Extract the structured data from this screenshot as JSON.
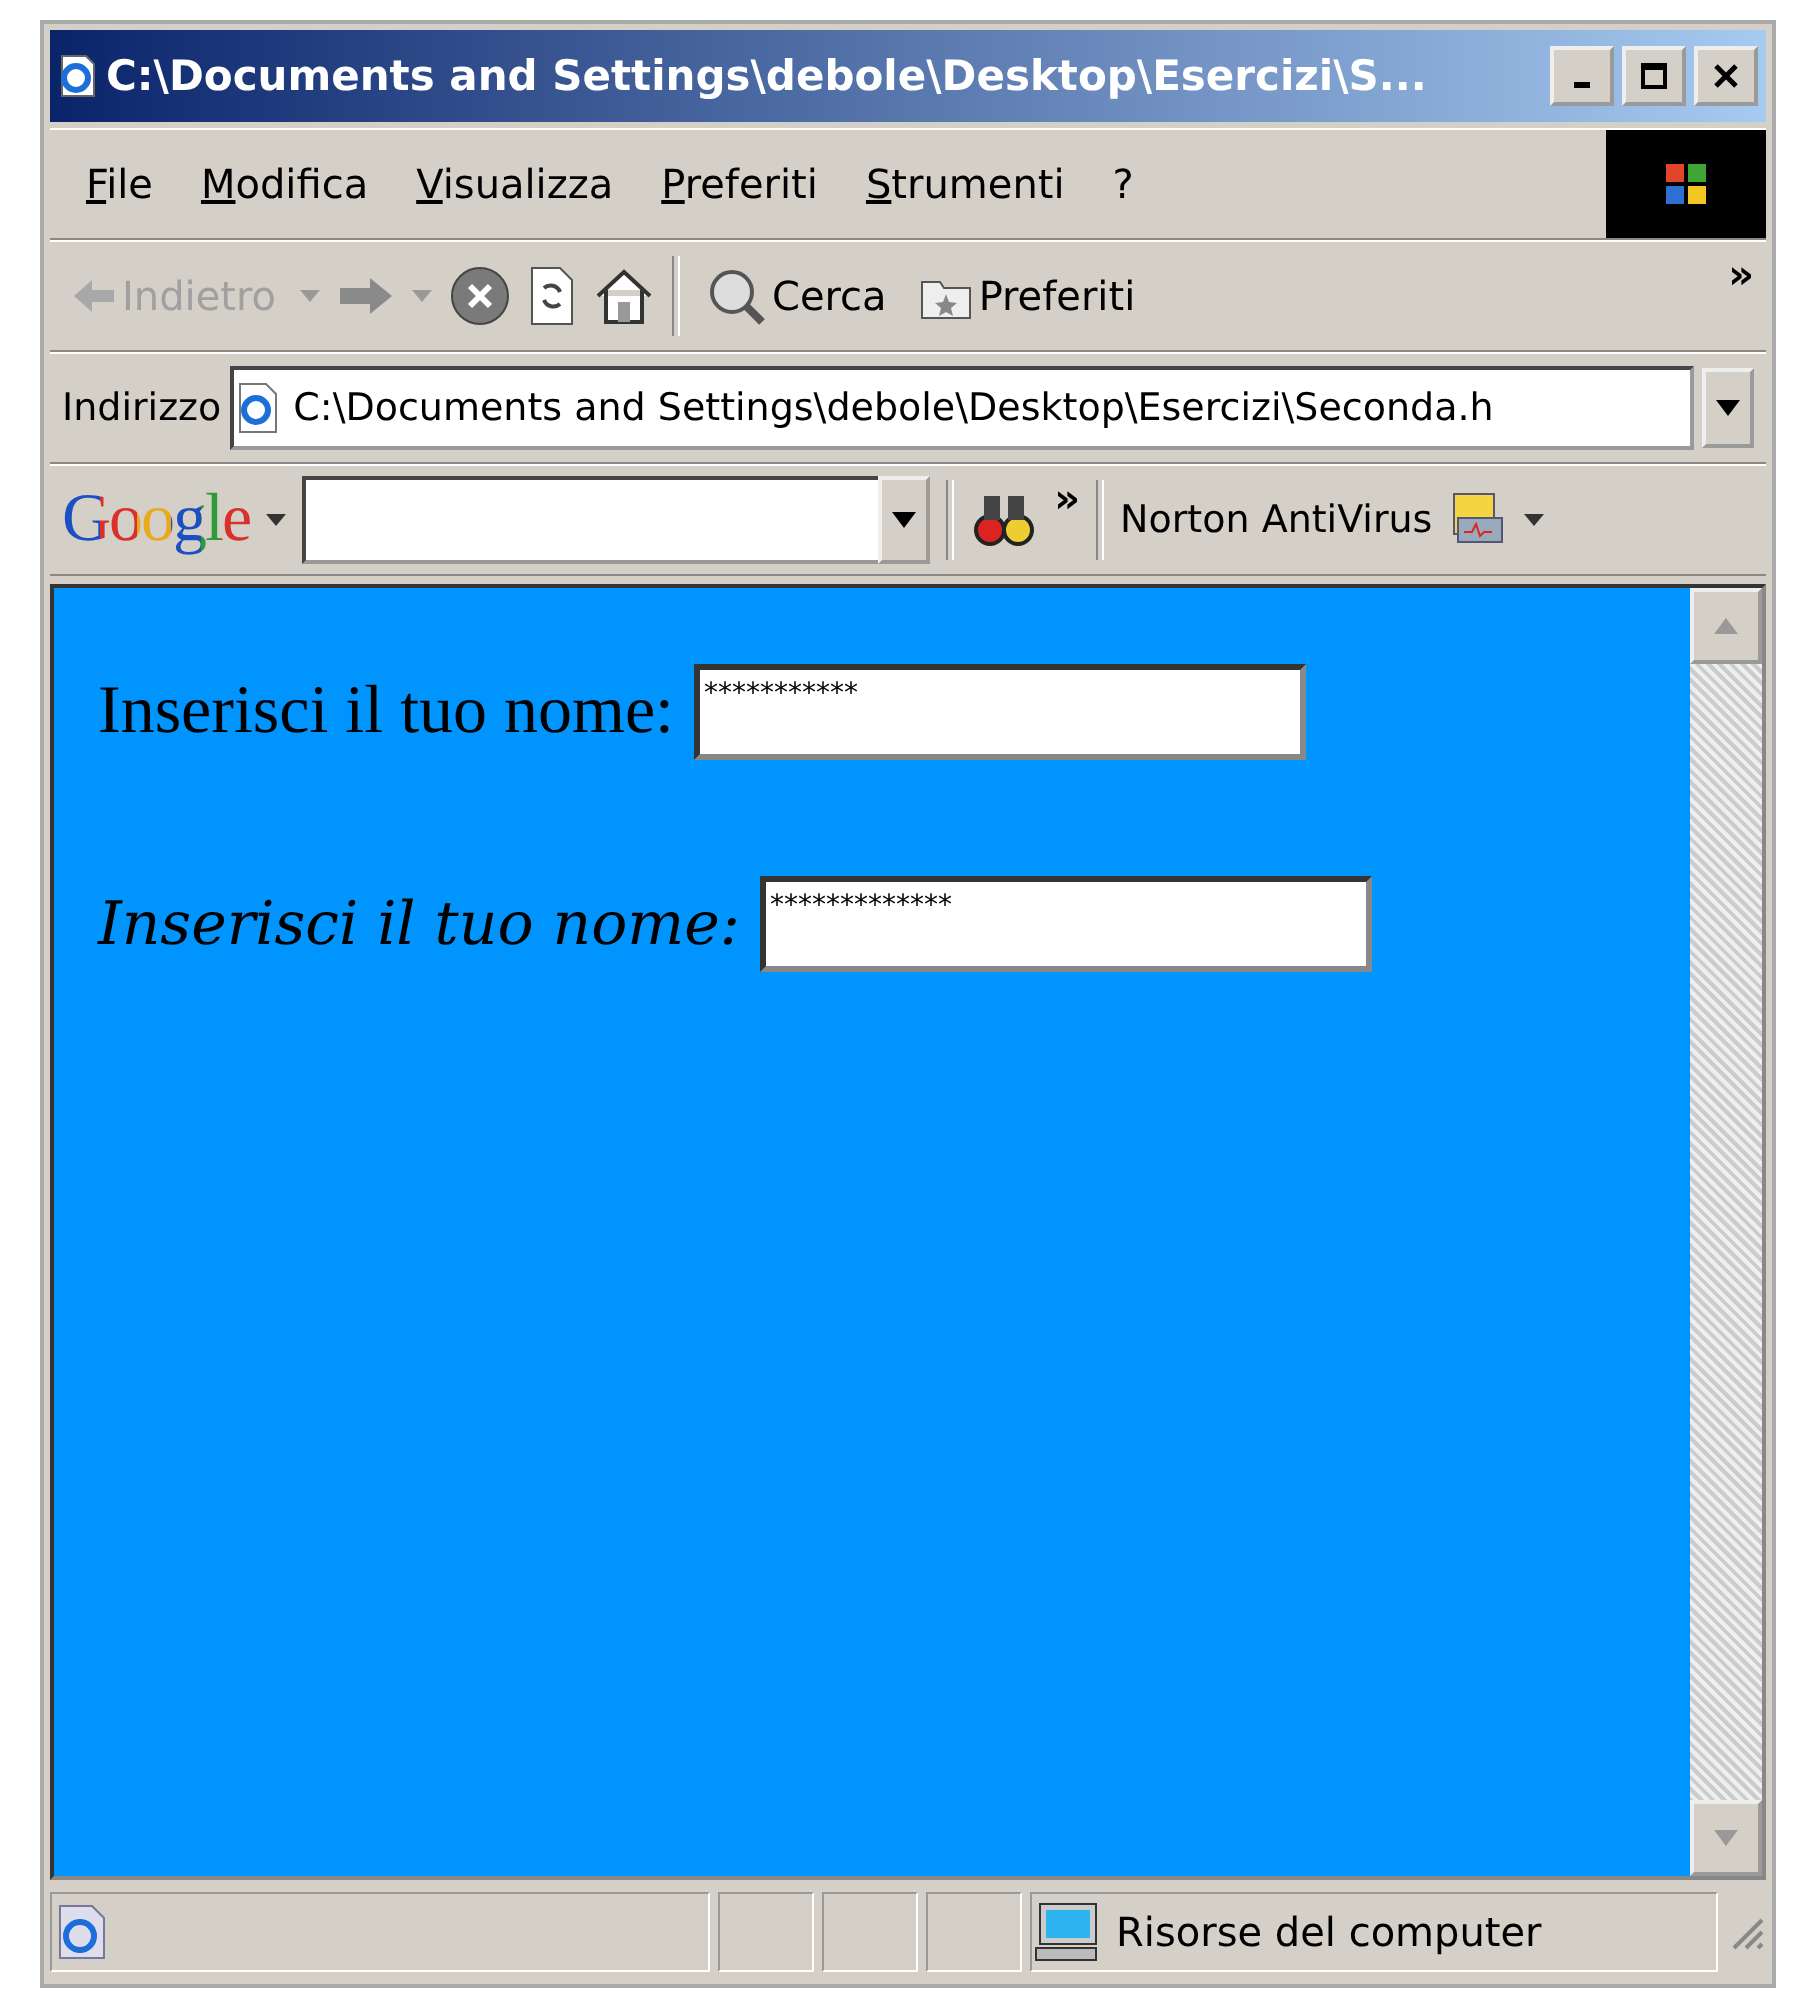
{
  "window": {
    "title": "C:\\Documents and Settings\\debole\\Desktop\\Esercizi\\S..."
  },
  "menu": [
    "File",
    "Modifica",
    "Visualizza",
    "Preferiti",
    "Strumenti",
    "?"
  ],
  "toolbar": {
    "back": {
      "label": "Indietro",
      "disabled": true
    },
    "search": "Cerca",
    "favorites": "Preferiti",
    "more": "»"
  },
  "address": {
    "label": "Indirizzo",
    "value": "C:\\Documents and Settings\\debole\\Desktop\\Esercizi\\Seconda.h"
  },
  "google_bar": {
    "logo": "Google",
    "more": "»",
    "norton": "Norton AntiVirus"
  },
  "form": [
    {
      "label": "Inserisci il tuo nome:",
      "kind": "plain",
      "value": "***********"
    },
    {
      "label": "Inserisci il tuo nome:",
      "kind": "italic",
      "value": "*************"
    }
  ],
  "status_bar": {
    "zone": "Risorse del computer"
  }
}
